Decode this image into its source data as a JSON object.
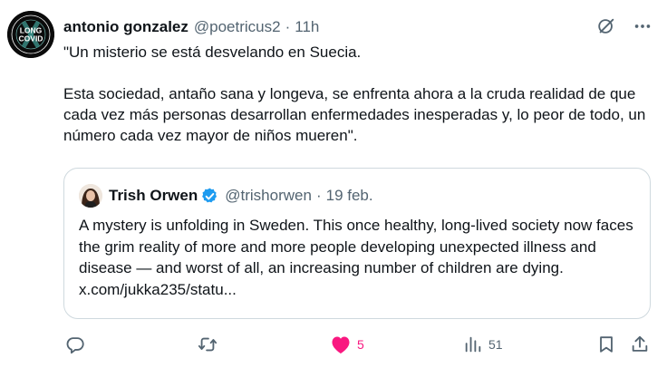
{
  "author": {
    "display_name": "antonio gonzalez",
    "handle": "@poetricus2",
    "separator": "·",
    "time": "11h",
    "avatar_text": {
      "top": "LONG",
      "bottom": "COVID"
    }
  },
  "body": {
    "line1": "\"Un misterio se está desvelando en Suecia.",
    "line2": "Esta sociedad, antaño sana y longeva, se enfrenta ahora a la cruda realidad de que cada vez más personas desarrollan enfermedades inesperadas y, lo peor de todo, un número cada vez mayor de niños mueren\"."
  },
  "quote": {
    "display_name": "Trish Orwen",
    "handle": "@trishorwen",
    "separator": "·",
    "time": "19 feb.",
    "text": "A mystery is unfolding in Sweden. This once healthy, long-lived society now faces the grim reality of more and more people developing unexpected illness and disease — and worst of all, an increasing number of children are dying. x.com/jukka235/statu..."
  },
  "actions": {
    "reply_icon": "reply-icon",
    "retweet_icon": "retweet-icon",
    "like_icon": "heart-filled-icon",
    "like_count": "5",
    "views_icon": "views-icon",
    "views_count": "51",
    "bookmark_icon": "bookmark-icon",
    "share_icon": "share-icon"
  },
  "colors": {
    "like": "#f91880",
    "verified": "#1d9bf0",
    "secondary_text": "#536471",
    "border": "#cfd9de"
  }
}
